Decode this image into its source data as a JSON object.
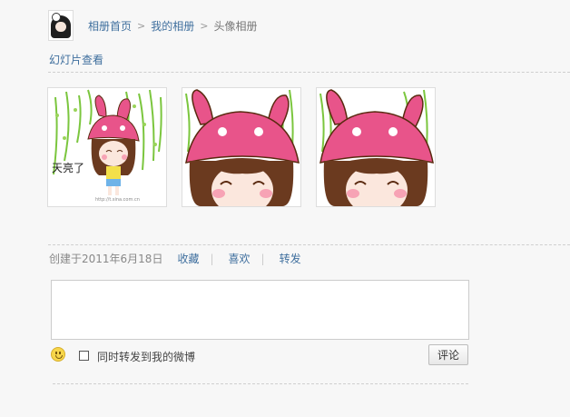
{
  "breadcrumb": {
    "home": "相册首页",
    "my_album": "我的相册",
    "current": "头像相册"
  },
  "slideshow_label": "幻灯片查看",
  "photos": [
    {
      "icon": "cartoon-girl-bunny-hat-full-photo",
      "overlay_text": "天亮了"
    },
    {
      "icon": "cartoon-girl-bunny-hat-closeup-photo"
    },
    {
      "icon": "cartoon-girl-bunny-hat-closeup-photo"
    }
  ],
  "meta": {
    "created": "创建于2011年6月18日",
    "favorite": "收藏",
    "like": "喜欢",
    "repost": "转发",
    "divider": "|"
  },
  "comment": {
    "placeholder": "",
    "value": "",
    "emoji_icon": "smiley-icon",
    "repost_label": "同时转发到我的微博",
    "repost_checked": false,
    "submit": "评论"
  },
  "colors": {
    "link": "#3f6f9e",
    "background": "#f7f7f7",
    "hat_pink": "#e8548a",
    "hair_brown": "#6b3a1f"
  }
}
